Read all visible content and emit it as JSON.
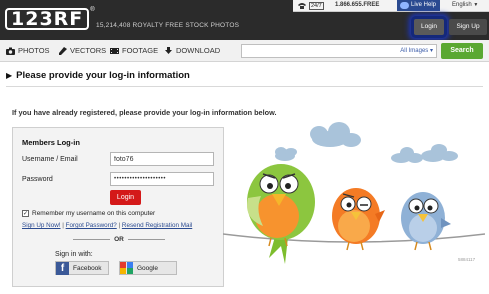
{
  "header": {
    "logo": "123RF",
    "logo_mark": "®",
    "tagline": "15,214,408 ROYALTY FREE STOCK PHOTOS",
    "badge_247": "24/7",
    "phone": "1.866.655.FREE",
    "live_help": "Live Help",
    "language": "English",
    "login_label": "Login",
    "signup_label": "Sign Up"
  },
  "nav": {
    "items": [
      {
        "label": "PHOTOS",
        "icon": "camera-icon"
      },
      {
        "label": "VECTORS",
        "icon": "pen-icon"
      },
      {
        "label": "FOOTAGE",
        "icon": "film-icon"
      },
      {
        "label": "DOWNLOAD",
        "icon": "download-icon"
      }
    ],
    "search_value": "",
    "search_scope": "All Images",
    "search_button": "Search"
  },
  "page": {
    "heading": "Please provide your log-in information",
    "intro": "If you have already registered, please provide your log-in information below."
  },
  "login": {
    "title": "Members Log-in",
    "username_label": "Username / Email",
    "username_value": "foto76",
    "password_label": "Password",
    "password_value": "••••••••••••••••••••",
    "submit_label": "Login",
    "remember_label": "Remember my username on this computer",
    "remember_checked": true,
    "links": [
      "Sign Up Now!",
      "Forgot Password?",
      "Resend Registration Mail"
    ],
    "link_separator": "|",
    "or_label": "OR",
    "signin_with": "Sign in with:",
    "facebook_label": "Facebook",
    "google_label": "Google"
  },
  "illustration": {
    "image_id": "5884117"
  },
  "colors": {
    "topbar": "#2b2b2b",
    "login_glow": "#1b36c0",
    "search_green": "#5aa832",
    "submit_red": "#d41919",
    "facebook_blue": "#3b5998"
  }
}
